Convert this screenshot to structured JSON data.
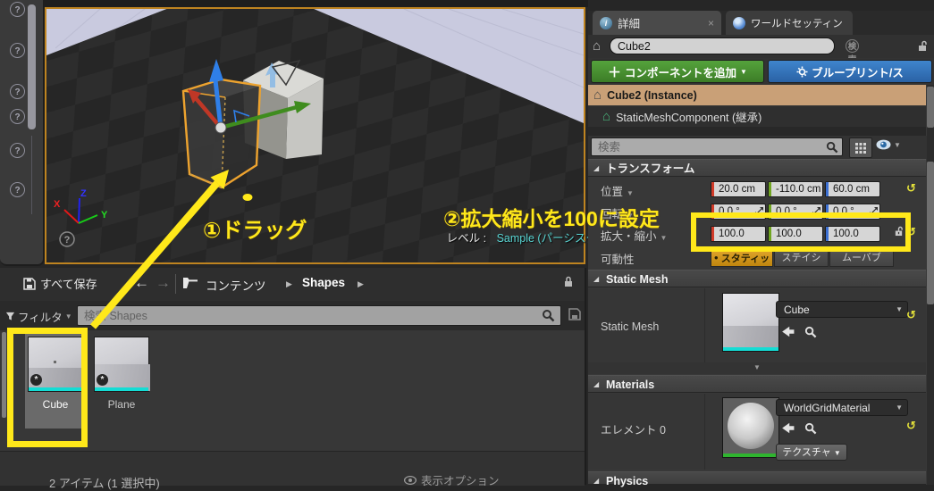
{
  "glyphs": {
    "caret_down": "▼",
    "crumb_sep": "▶",
    "expand_tri": "◢",
    "reset": "↺",
    "star": "*",
    "back": "←",
    "forward": "→",
    "close": "×",
    "info": "i",
    "circle": "●",
    "expander": "▼"
  },
  "colors": {
    "annotation_yellow": "#ffe81a",
    "viewport_border_orange": "#bf8420",
    "mobility_selected_orange": "#d29019",
    "level_value_cyan": "#5ad6d4",
    "selected_row_tan": "#c9a077"
  },
  "viewport": {
    "level_label": "レベル :",
    "level_value": "Sample (パーシスタント)",
    "axis_x": "X",
    "axis_y": "Y",
    "axis_z": "Z",
    "help_glyph": "?"
  },
  "left_toolbar": {
    "help_glyph": "?"
  },
  "annotations": {
    "step1": "①ドラッグ",
    "step2": "②拡大縮小を100に設定"
  },
  "content_browser": {
    "save_all_label": "すべて保存",
    "breadcrumb": {
      "root": "コンテンツ",
      "current": "Shapes"
    },
    "filter_label": "フィルタ",
    "search_placeholder": "検索 Shapes",
    "assets": [
      {
        "name": "Cube"
      },
      {
        "name": "Plane"
      }
    ],
    "status_text": "2 アイテム (1 選択中)",
    "view_options_label": "表示オプション"
  },
  "details_panel": {
    "tabs": [
      {
        "label": "詳細"
      },
      {
        "label": "ワールドセッティン"
      }
    ],
    "name_value": "Cube2",
    "add_component_label": "コンポーネントを追加",
    "blueprint_label": "ブループリント/ス",
    "components": [
      {
        "label": "Cube2 (Instance)"
      },
      {
        "label": "StaticMeshComponent (継承)"
      }
    ],
    "search_placeholder": "検索",
    "transform": {
      "title": "トランスフォーム",
      "location_label": "位置",
      "rotation_label": "回転",
      "scale_label": "拡大・縮小",
      "mobility_label": "可動性",
      "location": {
        "x": "20.0 cm",
        "y": "-110.0 cm",
        "z": "60.0 cm"
      },
      "rotation": {
        "x": "0.0 °",
        "y": "0.0 °",
        "z": "0.0 °"
      },
      "scale": {
        "x": "100.0",
        "y": "100.0",
        "z": "100.0"
      },
      "mobility_options": [
        {
          "label": "スタティッ"
        },
        {
          "label": "ステイシ"
        },
        {
          "label": "ムーバブ"
        }
      ]
    },
    "static_mesh": {
      "title": "Static Mesh",
      "row_label": "Static Mesh",
      "value": "Cube"
    },
    "materials": {
      "title": "Materials",
      "row_label": "エレメント 0",
      "value": "WorldGridMaterial",
      "texture_label": "テクスチャ"
    },
    "physics": {
      "title": "Physics"
    }
  }
}
